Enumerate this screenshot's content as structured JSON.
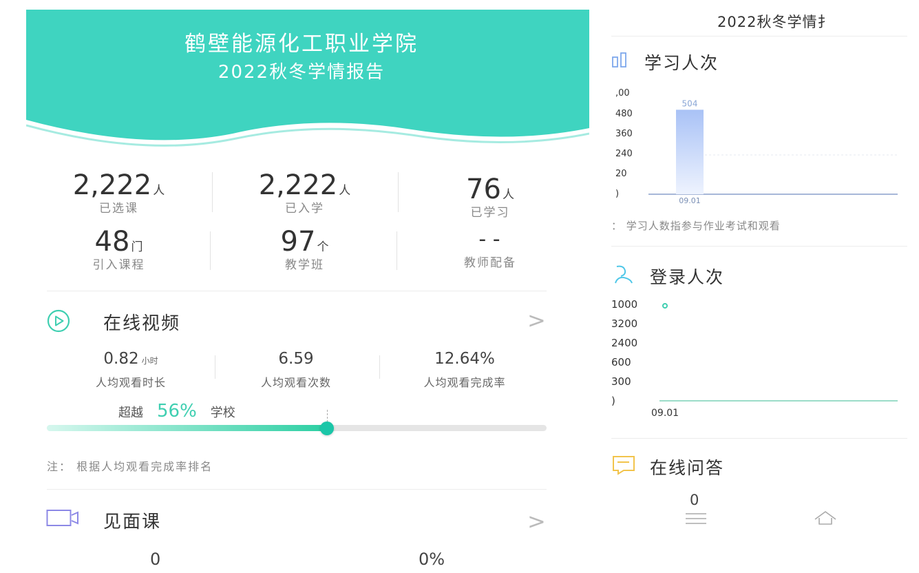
{
  "left": {
    "header": {
      "school_name": "鹤壁能源化工职业学院",
      "report_title": "2022秋冬学情报告",
      "banner_color": "#3fd4c0"
    },
    "stats": [
      {
        "value": "2,222",
        "unit": "人",
        "label": "已选课"
      },
      {
        "value": "2,222",
        "unit": "人",
        "label": "已入学"
      },
      {
        "value": "76",
        "unit": "人",
        "label": "已学习"
      },
      {
        "value": "48",
        "unit": "门",
        "label": "引入课程"
      },
      {
        "value": "97",
        "unit": "个",
        "label": "教学班"
      },
      {
        "value": "- -",
        "unit": "",
        "label": "教师配备"
      }
    ],
    "online_video": {
      "title": "在线视频",
      "chevron": ">",
      "stats": [
        {
          "value": "0.82",
          "unit": "小时",
          "label": "人均观看时长"
        },
        {
          "value": "6.59",
          "unit": "",
          "label": "人均观看次数"
        },
        {
          "value": "12.64%",
          "unit": "",
          "label": "人均观看完成率"
        }
      ],
      "rank": {
        "prefix": "超越",
        "percent_text": "56%",
        "suffix": "学校",
        "percent": 56
      },
      "note": "注：  根据人均观看完成率排名"
    },
    "meeting_class": {
      "title": "见面课",
      "chevron": ">",
      "values": [
        "0",
        "0%"
      ]
    }
  },
  "right": {
    "header_title": "2022秋冬学情扌",
    "study_count": {
      "title": "学习人次",
      "y_ticks": [
        ",00",
        "480",
        "360",
        "240",
        "20",
        ")"
      ],
      "note": "：  学习人数指参与作业考试和观看"
    },
    "login_count": {
      "title": "登录人次",
      "y_ticks": [
        "1000",
        "3200",
        "2400",
        "600",
        "300",
        ")"
      ]
    },
    "qa": {
      "title": "在线问答",
      "value": "0"
    }
  },
  "chart_data": [
    {
      "type": "bar",
      "title": "学习人次",
      "categories": [
        "09.01"
      ],
      "values": [
        504
      ],
      "ylim": [
        0,
        600
      ]
    },
    {
      "type": "line",
      "title": "登录人次",
      "x": [
        "09.01"
      ],
      "values": [
        4000
      ],
      "ylim": [
        0,
        4000
      ]
    }
  ]
}
